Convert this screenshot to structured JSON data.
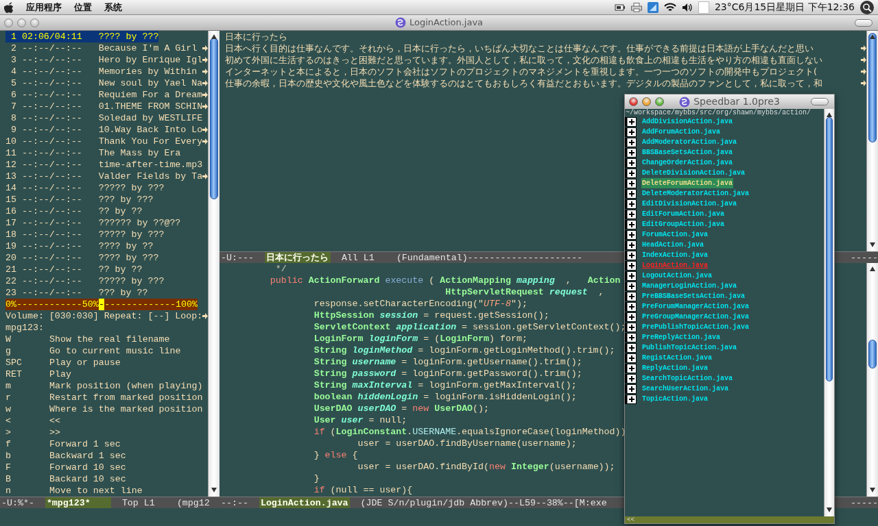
{
  "menubar": {
    "menus": [
      "应用程序",
      "位置",
      "系统"
    ],
    "clock": "23°C6月15日星期日 下午12:36"
  },
  "window": {
    "title": "LoginAction.java"
  },
  "playlist": {
    "rows": [
      {
        "number": "1",
        "time": "02:06/04:11",
        "title": "???? by ???",
        "truncated": false,
        "selected": true
      },
      {
        "number": "2",
        "time": "--:--/--:--",
        "title": "Because I'm A Girl",
        "truncated": true,
        "selected": false
      },
      {
        "number": "3",
        "time": "--:--/--:--",
        "title": "Hero by Enrique Igl",
        "truncated": true,
        "selected": false
      },
      {
        "number": "4",
        "time": "--:--/--:--",
        "title": "Memories by Within",
        "truncated": true,
        "selected": false
      },
      {
        "number": "5",
        "time": "--:--/--:--",
        "title": "New soul by Yael Na",
        "truncated": true,
        "selected": false
      },
      {
        "number": "6",
        "time": "--:--/--:--",
        "title": "Requiem For a Dream",
        "truncated": true,
        "selected": false
      },
      {
        "number": "7",
        "time": "--:--/--:--",
        "title": "01.THEME FROM SCHIN",
        "truncated": true,
        "selected": false
      },
      {
        "number": "8",
        "time": "--:--/--:--",
        "title": "Soledad by WESTLIFE",
        "truncated": false,
        "selected": false
      },
      {
        "number": "9",
        "time": "--:--/--:--",
        "title": "10.Way Back Into Lo",
        "truncated": true,
        "selected": false
      },
      {
        "number": "10",
        "time": "--:--/--:--",
        "title": "Thank You For Every",
        "truncated": true,
        "selected": false
      },
      {
        "number": "11",
        "time": "--:--/--:--",
        "title": "The Mass by Era",
        "truncated": false,
        "selected": false
      },
      {
        "number": "12",
        "time": "--:--/--:--",
        "title": "time-after-time.mp3",
        "truncated": false,
        "selected": false
      },
      {
        "number": "13",
        "time": "--:--/--:--",
        "title": "Valder Fields by Ta",
        "truncated": true,
        "selected": false
      },
      {
        "number": "14",
        "time": "--:--/--:--",
        "title": "????? by ???",
        "truncated": false,
        "selected": false
      },
      {
        "number": "15",
        "time": "--:--/--:--",
        "title": "??? by ???",
        "truncated": false,
        "selected": false
      },
      {
        "number": "16",
        "time": "--:--/--:--",
        "title": "?? by ??",
        "truncated": false,
        "selected": false
      },
      {
        "number": "17",
        "time": "--:--/--:--",
        "title": "?????? by ??@??",
        "truncated": false,
        "selected": false
      },
      {
        "number": "18",
        "time": "--:--/--:--",
        "title": "????? by ???",
        "truncated": false,
        "selected": false
      },
      {
        "number": "19",
        "time": "--:--/--:--",
        "title": "???? by ??",
        "truncated": false,
        "selected": false
      },
      {
        "number": "20",
        "time": "--:--/--:--",
        "title": "???? by ???",
        "truncated": false,
        "selected": false
      },
      {
        "number": "21",
        "time": "--:--/--:--",
        "title": "?? by ??",
        "truncated": false,
        "selected": false
      },
      {
        "number": "22",
        "time": "--:--/--:--",
        "title": "????? by ???",
        "truncated": false,
        "selected": false
      },
      {
        "number": "23",
        "time": "--:--/--:--",
        "title": "??? by ??",
        "truncated": false,
        "selected": false
      }
    ]
  },
  "progress": {
    "left": "0%------------50%",
    "marker": "-",
    "right": "-------------100%",
    "level": 0.5
  },
  "status_line": {
    "text": "Volume: [030:030] Repeat: [--] Loop:",
    "truncated": true
  },
  "help": {
    "heading": "mpg123:",
    "keys": [
      {
        "key": "W",
        "description": "Show the real filename"
      },
      {
        "key": "g",
        "description": "Go to current music line"
      },
      {
        "key": "SPC",
        "description": "Play or pause"
      },
      {
        "key": "RET",
        "description": "Play"
      },
      {
        "key": "m",
        "description": "Mark position (when playing)"
      },
      {
        "key": "r",
        "description": "Restart from marked position"
      },
      {
        "key": "w",
        "description": "Where is the marked position"
      },
      {
        "key": "<",
        "description": "<<"
      },
      {
        "key": ">",
        "description": ">>"
      },
      {
        "key": "f",
        "description": "Forward 1 sec"
      },
      {
        "key": "b",
        "description": "Backward 1 sec"
      },
      {
        "key": "F",
        "description": "Forward 10 sec"
      },
      {
        "key": "B",
        "description": "Backard 10 sec"
      },
      {
        "key": "n",
        "description": "Move to next line"
      }
    ]
  },
  "left_mode_line": {
    "segments": [
      {
        "kind": "flags",
        "text": "-U:%*-"
      },
      {
        "kind": "buffer",
        "text": "*mpg123*"
      },
      {
        "kind": "position",
        "text": "Top L1"
      },
      {
        "kind": "modes",
        "text": "(mpg12"
      }
    ]
  },
  "text_buffer": {
    "lines": [
      {
        "text": "日本に行ったら",
        "truncated": false
      },
      {
        "text": "日本へ行く目的は仕事なんです。それから，日本に行ったら，いちばん大切なことは仕事なんです。仕事ができる前提は日本語が上手なんだと思い",
        "truncated": true
      },
      {
        "text": "初めて外国に生活するのはきっと困難だと思っています。外国人として，私に取って，文化の相違も飲食上の相違も生活をやり方の相違も直面しない",
        "truncated": true
      },
      {
        "text": "インターネットと本によると，日本のソフト会社はソフトのプロジェクトのマネジメントを重視します。一つ一つのソフトの開発中もプロジェクト(",
        "truncated": true
      },
      {
        "text": "仕事の余暇，日本の歴史や文化や風土色などを体験するのはとてもおもしろく有益だとおもいます。デジタルの製品のファンとして，私に取って，和",
        "truncated": true
      }
    ]
  },
  "text_mode_line": {
    "segments": [
      {
        "kind": "flags",
        "text": "-U:---"
      },
      {
        "kind": "buffer",
        "text": "日本に行ったら"
      },
      {
        "kind": "position",
        "text": "All L1"
      },
      {
        "kind": "modes",
        "text": "(Fundamental)---------------------"
      }
    ],
    "tail": "-----"
  },
  "code": {
    "lines": [
      [
        {
          "kind": "comment",
          "text": "          */"
        }
      ],
      [
        {
          "kind": "kw",
          "text": "         public"
        },
        {
          "kind": "type",
          "text": " ActionForward"
        },
        {
          "kind": "fn",
          "text": " execute"
        },
        {
          "kind": "plain",
          "text": " ( "
        },
        {
          "kind": "type",
          "text": "ActionMapping"
        },
        {
          "kind": "var",
          "text": " mapping"
        },
        {
          "kind": "plain",
          "text": "  ,   "
        },
        {
          "kind": "type",
          "text": "Action"
        }
      ],
      [
        {
          "kind": "type",
          "text": "                                         HttpServletRequest"
        },
        {
          "kind": "var",
          "text": " request"
        },
        {
          "kind": "plain",
          "text": "  ,"
        }
      ],
      [
        {
          "kind": "plain",
          "text": "                 response.setCharacterEncoding(\""
        },
        {
          "kind": "str",
          "text": "UTF-8"
        },
        {
          "kind": "plain",
          "text": "\");"
        }
      ],
      [
        {
          "kind": "type",
          "text": "                 HttpSession"
        },
        {
          "kind": "var",
          "text": " session"
        },
        {
          "kind": "plain",
          "text": " = request.getSession();"
        }
      ],
      [
        {
          "kind": "type",
          "text": "                 ServletContext"
        },
        {
          "kind": "var",
          "text": " application"
        },
        {
          "kind": "plain",
          "text": " = session.getServletContext();"
        }
      ],
      [
        {
          "kind": "type",
          "text": "                 LoginForm"
        },
        {
          "kind": "var",
          "text": " loginForm"
        },
        {
          "kind": "plain",
          "text": " = ("
        },
        {
          "kind": "type",
          "text": "LoginForm"
        },
        {
          "kind": "plain",
          "text": ") form;"
        }
      ],
      [
        {
          "kind": "type",
          "text": "                 String"
        },
        {
          "kind": "var",
          "text": " loginMethod"
        },
        {
          "kind": "plain",
          "text": " = loginForm.getLoginMethod().trim();"
        }
      ],
      [
        {
          "kind": "type",
          "text": "                 String"
        },
        {
          "kind": "var",
          "text": " username"
        },
        {
          "kind": "plain",
          "text": " = loginForm.getUsername().trim();"
        }
      ],
      [
        {
          "kind": "type",
          "text": "                 String"
        },
        {
          "kind": "var",
          "text": " password"
        },
        {
          "kind": "plain",
          "text": " = loginForm.getPassword().trim();"
        }
      ],
      [
        {
          "kind": "type",
          "text": "                 String"
        },
        {
          "kind": "var",
          "text": " maxInterval"
        },
        {
          "kind": "plain",
          "text": " = loginForm.getMaxInterval();"
        }
      ],
      [
        {
          "kind": "type",
          "text": "                 boolean"
        },
        {
          "kind": "var",
          "text": " hiddenLogin"
        },
        {
          "kind": "plain",
          "text": " = loginForm.isHiddenLogin();"
        }
      ],
      [
        {
          "kind": "type",
          "text": "                 UserDAO"
        },
        {
          "kind": "var",
          "text": " userDAO"
        },
        {
          "kind": "plain",
          "text": " = "
        },
        {
          "kind": "kw",
          "text": "new"
        },
        {
          "kind": "type",
          "text": " UserDAO"
        },
        {
          "kind": "plain",
          "text": "();"
        }
      ],
      [
        {
          "kind": "type",
          "text": "                 User"
        },
        {
          "kind": "var",
          "text": " user"
        },
        {
          "kind": "plain",
          "text": " = null;"
        }
      ],
      [
        {
          "kind": "kw",
          "text": "                 if"
        },
        {
          "kind": "plain",
          "text": " ("
        },
        {
          "kind": "type",
          "text": "LoginConstant"
        },
        {
          "kind": "plain",
          "text": "."
        },
        {
          "kind": "const",
          "text": "USERNAME"
        },
        {
          "kind": "plain",
          "text": ".equalsIgnoreCase(loginMethod))"
        }
      ],
      [
        {
          "kind": "plain",
          "text": "                         user = userDAO.findByUsername(username);"
        }
      ],
      [
        {
          "kind": "plain",
          "text": "                 } "
        },
        {
          "kind": "kw",
          "text": "else"
        },
        {
          "kind": "plain",
          "text": " {"
        }
      ],
      [
        {
          "kind": "plain",
          "text": "                         user = userDAO.findById("
        },
        {
          "kind": "kw",
          "text": "new"
        },
        {
          "kind": "type",
          "text": " Integer"
        },
        {
          "kind": "plain",
          "text": "(username));"
        }
      ],
      [
        {
          "kind": "plain",
          "text": "                 }"
        }
      ],
      [
        {
          "kind": "kw",
          "text": "                 if"
        },
        {
          "kind": "plain",
          "text": " (null == user){"
        }
      ]
    ]
  },
  "code_mode_line": {
    "segments": [
      {
        "kind": "flags",
        "text": "--:--"
      },
      {
        "kind": "buffer",
        "text": "LoginAction.java"
      },
      {
        "kind": "modes",
        "text": "(JDE S/n/plugin/jdb Abbrev)--L59--38%--[M:exe"
      }
    ],
    "tail": "-----"
  },
  "speedbar": {
    "title": "Speedbar 1.0pre3",
    "path": "~/workspace/mybbs/src/org/shawn/mybbs/action/",
    "footer": "<<",
    "items": [
      {
        "name": "AddDivisionAction.java",
        "selected": false,
        "current": false
      },
      {
        "name": "AddForumAction.java",
        "selected": false,
        "current": false
      },
      {
        "name": "AddModeratorAction.java",
        "selected": false,
        "current": false
      },
      {
        "name": "BBSBaseSetsAction.java",
        "selected": false,
        "current": false
      },
      {
        "name": "ChangeOrderAction.java",
        "selected": false,
        "current": false
      },
      {
        "name": "DeleteDivisionAction.java",
        "selected": false,
        "current": false
      },
      {
        "name": "DeleteForumAction.java",
        "selected": true,
        "current": false
      },
      {
        "name": "DeleteModeratorAction.java",
        "selected": false,
        "current": false
      },
      {
        "name": "EditDivisionAction.java",
        "selected": false,
        "current": false
      },
      {
        "name": "EditForumAction.java",
        "selected": false,
        "current": false
      },
      {
        "name": "EditGroupAction.java",
        "selected": false,
        "current": false
      },
      {
        "name": "ForumAction.java",
        "selected": false,
        "current": false
      },
      {
        "name": "HeadAction.java",
        "selected": false,
        "current": false
      },
      {
        "name": "IndexAction.java",
        "selected": false,
        "current": false
      },
      {
        "name": "LoginAction.java",
        "selected": false,
        "current": true
      },
      {
        "name": "LogoutAction.java",
        "selected": false,
        "current": false
      },
      {
        "name": "ManagerLoginAction.java",
        "selected": false,
        "current": false
      },
      {
        "name": "PreBBSBaseSetsAction.java",
        "selected": false,
        "current": false
      },
      {
        "name": "PreForumManagerAction.java",
        "selected": false,
        "current": false
      },
      {
        "name": "PreGroupManagerAction.java",
        "selected": false,
        "current": false
      },
      {
        "name": "PrePublishTopicAction.java",
        "selected": false,
        "current": false
      },
      {
        "name": "PreReplyAction.java",
        "selected": false,
        "current": false
      },
      {
        "name": "PublishTopicAction.java",
        "selected": false,
        "current": false
      },
      {
        "name": "RegistAction.java",
        "selected": false,
        "current": false
      },
      {
        "name": "ReplyAction.java",
        "selected": false,
        "current": false
      },
      {
        "name": "SearchTopicAction.java",
        "selected": false,
        "current": false
      },
      {
        "name": "SearchUserAction.java",
        "selected": false,
        "current": false
      },
      {
        "name": "TopicAction.java",
        "selected": false,
        "current": false
      }
    ]
  }
}
